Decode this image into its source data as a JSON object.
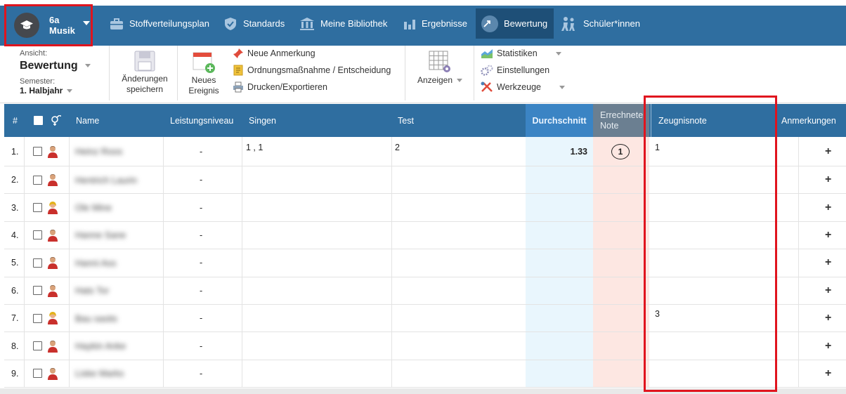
{
  "class_switcher": {
    "grade": "6a",
    "subject": "Musik"
  },
  "nav": [
    {
      "label": "Stoffverteilungsplan",
      "icon": "briefcase-icon"
    },
    {
      "label": "Standards",
      "icon": "shield-check-icon"
    },
    {
      "label": "Meine Bibliothek",
      "icon": "library-icon"
    },
    {
      "label": "Ergebnisse",
      "icon": "bar-chart-icon"
    },
    {
      "label": "Bewertung",
      "icon": "rating-icon",
      "active": true
    },
    {
      "label": "Schüler*innen",
      "icon": "students-icon"
    }
  ],
  "toolbar": {
    "view_label": "Ansicht:",
    "view_value": "Bewertung",
    "semester_label": "Semester:",
    "semester_value": "1. Halbjahr",
    "save_line1": "Änderungen",
    "save_line2": "speichern",
    "event_line1": "Neues",
    "event_line2": "Ereignis",
    "new_note": "Neue Anmerkung",
    "measure": "Ordnungsmaßnahme / Entscheidung",
    "print": "Drucken/Exportieren",
    "display": "Anzeigen",
    "statistics": "Statistiken",
    "settings": "Einstellungen",
    "tools": "Werkzeuge"
  },
  "table": {
    "headers": {
      "num": "#",
      "name": "Name",
      "level": "Leistungsniveau",
      "singen": "Singen",
      "test": "Test",
      "average": "Durchschnitt",
      "calc_line1": "Errechnete",
      "calc_line2": "Note",
      "grade": "Zeugnisnote",
      "notes": "Anmerkungen"
    },
    "rows": [
      {
        "num": "1.",
        "name": "Heinz Roos",
        "gender": "male",
        "level": "-",
        "singen": "1 , 1",
        "test": "2",
        "average": "1.33",
        "calc": "1",
        "grade": "1"
      },
      {
        "num": "2.",
        "name": "Hentrich Laurin",
        "gender": "male",
        "level": "-",
        "singen": "",
        "test": "",
        "average": "",
        "calc": "",
        "grade": ""
      },
      {
        "num": "3.",
        "name": "Ole Mine",
        "gender": "female",
        "level": "-",
        "singen": "",
        "test": "",
        "average": "",
        "calc": "",
        "grade": ""
      },
      {
        "num": "4.",
        "name": "Hanne Sane",
        "gender": "male",
        "level": "-",
        "singen": "",
        "test": "",
        "average": "",
        "calc": "",
        "grade": ""
      },
      {
        "num": "5.",
        "name": "Hanni Ass",
        "gender": "male",
        "level": "-",
        "singen": "",
        "test": "",
        "average": "",
        "calc": "",
        "grade": ""
      },
      {
        "num": "6.",
        "name": "Hats Tor",
        "gender": "male",
        "level": "-",
        "singen": "",
        "test": "",
        "average": "",
        "calc": "",
        "grade": ""
      },
      {
        "num": "7.",
        "name": "Bau sasits",
        "gender": "female",
        "level": "-",
        "singen": "",
        "test": "",
        "average": "",
        "calc": "",
        "grade": "3"
      },
      {
        "num": "8.",
        "name": "Haykin Anke",
        "gender": "male",
        "level": "-",
        "singen": "",
        "test": "",
        "average": "",
        "calc": "",
        "grade": ""
      },
      {
        "num": "9.",
        "name": "Liske Marks",
        "gender": "male",
        "level": "-",
        "singen": "",
        "test": "",
        "average": "",
        "calc": "",
        "grade": ""
      }
    ],
    "add_symbol": "+"
  },
  "colors": {
    "nav_bg": "#2f6ea0",
    "nav_active": "#1e4f77",
    "highlight_red": "#e0141e",
    "average_col": "#e9f6fd",
    "calc_col": "#fde7e2"
  }
}
